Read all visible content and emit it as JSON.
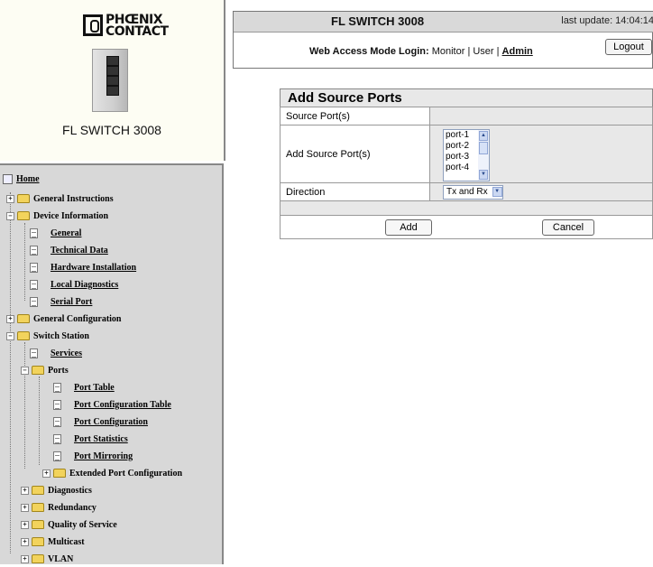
{
  "logo": {
    "line1": "PHŒNIX",
    "line2": "CONTACT"
  },
  "device_name": "FL SWITCH 3008",
  "nav": {
    "home": "Home",
    "general_instructions": "General Instructions",
    "device_information": "Device Information",
    "device_info_items": [
      "General",
      "Technical Data",
      "Hardware Installation",
      "Local Diagnostics",
      "Serial Port"
    ],
    "general_configuration": "General Configuration",
    "switch_station": "Switch Station",
    "services": "Services",
    "ports": "Ports",
    "ports_items": [
      "Port Table",
      "Port Configuration Table",
      "Port Configuration",
      "Port Statistics",
      "Port Mirroring"
    ],
    "extended_port_configuration": "Extended Port Configuration",
    "folders_bottom": [
      "Diagnostics",
      "Redundancy",
      "Quality of Service",
      "Multicast",
      "VLAN"
    ]
  },
  "header": {
    "title": "FL SWITCH 3008",
    "last_update": "last update: 14:04:14",
    "login_label": "Web Access Mode Login:",
    "login_modes": "Monitor | User | ",
    "admin": "Admin",
    "logout": "Logout"
  },
  "form": {
    "title": "Add Source Ports",
    "source_ports_label": "Source Port(s)",
    "source_ports_value": "",
    "add_source_label": "Add Source Port(s)",
    "port_options": [
      "port-1",
      "port-2",
      "port-3",
      "port-4"
    ],
    "direction_label": "Direction",
    "direction_value": "Tx and Rx",
    "add_button": "Add",
    "cancel_button": "Cancel"
  },
  "colors": {
    "nav_bg": "#d8d8d8",
    "header_bg": "#d9d9d9",
    "folder": "#f2d35c"
  }
}
